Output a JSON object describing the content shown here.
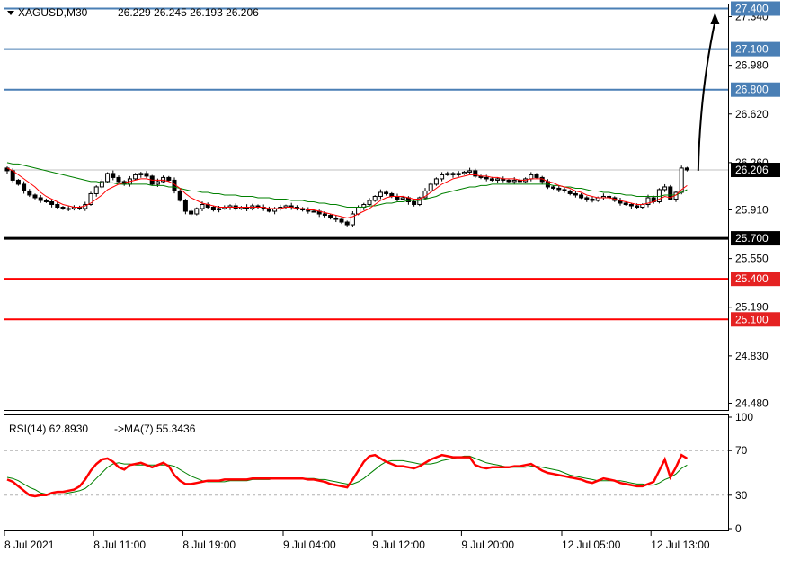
{
  "header": {
    "symbol_label": "XAGUSD,M30",
    "ohlc": "26.229 26.245 26.193 26.206"
  },
  "rsi_header": {
    "label": "RSI(14) 62.8930",
    "ma_label": "->MA(7) 55.3436"
  },
  "colors": {
    "bull": "#000000",
    "bear": "#000000",
    "ma_fast": "#ff0000",
    "ma_slow": "#008000",
    "resistance": "#4a7fb5",
    "support": "#ff0000",
    "pivot": "#000000",
    "rsi": "#ff0000",
    "rsi_ma": "#008000",
    "price_box_black": "#000000",
    "price_box_red": "#e52222",
    "price_box_blue": "#4a7fb5"
  },
  "chart_data": {
    "type": "candlestick",
    "symbol": "XAGUSD",
    "timeframe": "M30",
    "price_axis": {
      "ylim": [
        24.43,
        27.43
      ],
      "ticks": [
        "27.340",
        "26.980",
        "26.620",
        "26.260",
        "25.910",
        "25.550",
        "25.190",
        "24.830",
        "24.480"
      ]
    },
    "time_axis": {
      "labels": [
        "8 Jul 2021",
        "8 Jul 11:00",
        "8 Jul 19:00",
        "9 Jul 04:00",
        "9 Jul 12:00",
        "9 Jul 20:00",
        "12 Jul 05:00",
        "12 Jul 13:00"
      ],
      "label_bar_index": [
        0,
        16,
        32,
        50,
        66,
        82,
        100,
        116
      ]
    },
    "levels": [
      {
        "price": 27.4,
        "label": "27.400",
        "kind": "resistance"
      },
      {
        "price": 27.1,
        "label": "27.100",
        "kind": "resistance"
      },
      {
        "price": 26.8,
        "label": "26.800",
        "kind": "resistance"
      },
      {
        "price": 25.7,
        "label": "25.700",
        "kind": "pivot"
      },
      {
        "price": 25.4,
        "label": "25.400",
        "kind": "support"
      },
      {
        "price": 25.1,
        "label": "25.100",
        "kind": "support"
      }
    ],
    "current_price": {
      "price": 26.206,
      "label": "26.206"
    },
    "arrow": {
      "from_bar": 124,
      "from_price": 26.2,
      "to_bar": 127,
      "to_price": 27.37
    },
    "close": [
      26.2,
      26.13,
      26.1,
      26.05,
      26.02,
      26.0,
      25.98,
      25.97,
      25.95,
      25.93,
      25.92,
      25.92,
      25.93,
      25.92,
      25.95,
      26.03,
      26.08,
      26.12,
      26.18,
      26.15,
      26.12,
      26.1,
      26.14,
      26.17,
      26.18,
      26.16,
      26.1,
      26.12,
      26.15,
      26.13,
      26.05,
      25.98,
      25.9,
      25.88,
      25.92,
      25.95,
      25.93,
      25.91,
      25.92,
      25.93,
      25.94,
      25.92,
      25.93,
      25.92,
      25.94,
      25.93,
      25.92,
      25.9,
      25.92,
      25.93,
      25.94,
      25.93,
      25.92,
      25.91,
      25.9,
      25.9,
      25.88,
      25.87,
      25.85,
      25.84,
      25.82,
      25.8,
      25.88,
      25.93,
      25.95,
      25.98,
      26.01,
      26.04,
      26.03,
      26.01,
      25.99,
      26.0,
      25.97,
      25.95,
      26.0,
      26.05,
      26.1,
      26.14,
      26.17,
      26.18,
      26.17,
      26.18,
      26.19,
      26.2,
      26.16,
      26.15,
      26.14,
      26.13,
      26.14,
      26.13,
      26.12,
      26.13,
      26.12,
      26.14,
      26.17,
      26.15,
      26.12,
      26.08,
      26.07,
      26.06,
      26.05,
      26.03,
      26.02,
      26.0,
      25.99,
      25.98,
      26.0,
      26.01,
      26.0,
      25.98,
      25.96,
      25.95,
      25.94,
      25.93,
      25.95,
      26.0,
      25.97,
      26.06,
      26.08,
      25.99,
      26.04,
      26.22,
      26.206
    ],
    "ma_fast": [
      26.22,
      26.2,
      26.17,
      26.14,
      26.11,
      26.08,
      26.04,
      26.01,
      25.99,
      25.97,
      25.95,
      25.94,
      25.93,
      25.93,
      25.94,
      25.96,
      25.99,
      26.02,
      26.06,
      26.08,
      26.1,
      26.11,
      26.12,
      26.13,
      26.14,
      26.14,
      26.13,
      26.13,
      26.13,
      26.12,
      26.1,
      26.07,
      26.03,
      26.0,
      25.98,
      25.96,
      25.95,
      25.94,
      25.93,
      25.93,
      25.93,
      25.93,
      25.93,
      25.93,
      25.93,
      25.93,
      25.93,
      25.92,
      25.92,
      25.92,
      25.93,
      25.93,
      25.92,
      25.92,
      25.91,
      25.91,
      25.9,
      25.89,
      25.88,
      25.87,
      25.86,
      25.85,
      25.86,
      25.88,
      25.9,
      25.92,
      25.95,
      25.98,
      26.0,
      26.01,
      26.01,
      26.01,
      26.0,
      25.99,
      25.99,
      26.01,
      26.04,
      26.07,
      26.1,
      26.12,
      26.14,
      26.15,
      26.16,
      26.17,
      26.17,
      26.16,
      26.16,
      26.15,
      26.15,
      26.14,
      26.14,
      26.14,
      26.13,
      26.13,
      26.14,
      26.14,
      26.14,
      26.12,
      26.11,
      26.09,
      26.08,
      26.07,
      26.05,
      26.04,
      26.02,
      26.01,
      26.0,
      26.0,
      26.0,
      25.99,
      25.98,
      25.97,
      25.96,
      25.95,
      25.95,
      25.96,
      25.97,
      25.99,
      26.01,
      26.0,
      26.02,
      26.06,
      26.09
    ],
    "ma_slow": [
      26.26,
      26.25,
      26.25,
      26.24,
      26.23,
      26.22,
      26.21,
      26.2,
      26.19,
      26.18,
      26.17,
      26.16,
      26.15,
      26.14,
      26.13,
      26.12,
      26.12,
      26.11,
      26.11,
      26.11,
      26.1,
      26.1,
      26.1,
      26.1,
      26.1,
      26.1,
      26.09,
      26.09,
      26.09,
      26.08,
      26.08,
      26.07,
      26.06,
      26.05,
      26.05,
      26.04,
      26.04,
      26.03,
      26.03,
      26.02,
      26.02,
      26.02,
      26.01,
      26.01,
      26.01,
      26.0,
      26.0,
      26.0,
      25.99,
      25.99,
      25.99,
      25.98,
      25.98,
      25.98,
      25.97,
      25.97,
      25.96,
      25.96,
      25.95,
      25.95,
      25.94,
      25.93,
      25.93,
      25.93,
      25.93,
      25.94,
      25.94,
      25.95,
      25.96,
      25.96,
      25.97,
      25.97,
      25.98,
      25.98,
      25.98,
      25.99,
      26.0,
      26.01,
      26.03,
      26.04,
      26.05,
      26.06,
      26.07,
      26.08,
      26.08,
      26.09,
      26.09,
      26.1,
      26.1,
      26.1,
      26.1,
      26.1,
      26.1,
      26.1,
      26.1,
      26.1,
      26.1,
      26.1,
      26.09,
      26.09,
      26.08,
      26.08,
      26.07,
      26.07,
      26.06,
      26.05,
      26.05,
      26.04,
      26.04,
      26.03,
      26.03,
      26.02,
      26.02,
      26.01,
      26.01,
      26.01,
      26.01,
      26.01,
      26.02,
      26.02,
      26.02,
      26.04,
      26.06
    ],
    "rsi": {
      "ylim": [
        0,
        100
      ],
      "ticks": [
        "100",
        "70",
        "30",
        "0"
      ],
      "levels": [
        70,
        30
      ],
      "values": [
        44,
        42,
        38,
        34,
        30,
        29,
        30,
        30,
        32,
        33,
        33,
        34,
        35,
        38,
        44,
        52,
        58,
        62,
        63,
        60,
        55,
        53,
        57,
        58,
        59,
        57,
        55,
        57,
        59,
        56,
        48,
        43,
        40,
        40,
        41,
        42,
        43,
        43,
        43,
        44,
        44,
        44,
        44,
        44,
        45,
        45,
        45,
        45,
        45,
        45,
        45,
        45,
        45,
        45,
        44,
        44,
        43,
        42,
        40,
        39,
        38,
        37,
        44,
        52,
        60,
        65,
        66,
        63,
        60,
        58,
        56,
        56,
        55,
        54,
        56,
        59,
        62,
        64,
        66,
        65,
        64,
        64,
        64,
        64,
        57,
        55,
        54,
        55,
        55,
        55,
        55,
        56,
        56,
        57,
        58,
        55,
        52,
        50,
        49,
        48,
        47,
        46,
        45,
        44,
        42,
        41,
        43,
        45,
        44,
        43,
        41,
        40,
        39,
        38,
        38,
        40,
        42,
        52,
        62,
        46,
        55,
        66,
        63
      ],
      "ma": [
        46,
        45,
        43,
        40,
        37,
        35,
        32,
        31,
        31,
        31,
        31,
        32,
        33,
        34,
        36,
        40,
        45,
        50,
        55,
        58,
        59,
        58,
        58,
        57,
        57,
        57,
        57,
        57,
        57,
        57,
        56,
        53,
        50,
        47,
        45,
        43,
        42,
        42,
        42,
        42,
        43,
        43,
        43,
        43,
        44,
        44,
        44,
        44,
        45,
        45,
        45,
        45,
        45,
        45,
        45,
        45,
        44,
        44,
        43,
        42,
        41,
        40,
        40,
        42,
        45,
        49,
        53,
        57,
        60,
        61,
        61,
        61,
        60,
        59,
        58,
        58,
        58,
        59,
        61,
        62,
        63,
        64,
        65,
        65,
        63,
        61,
        59,
        58,
        57,
        56,
        55,
        55,
        55,
        55,
        56,
        56,
        55,
        54,
        53,
        52,
        50,
        48,
        47,
        46,
        45,
        44,
        43,
        43,
        43,
        43,
        43,
        42,
        41,
        40,
        40,
        39,
        39,
        41,
        44,
        46,
        49,
        54,
        57
      ]
    }
  }
}
